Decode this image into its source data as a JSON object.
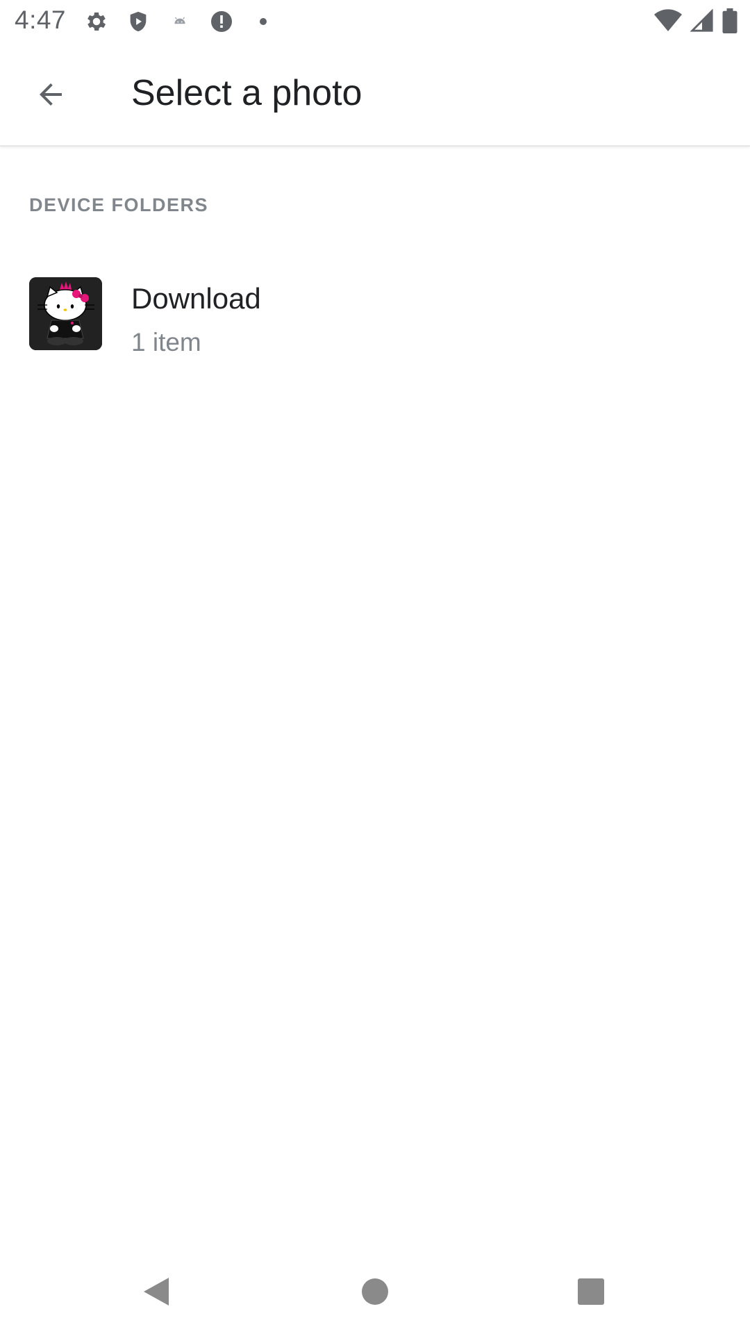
{
  "status_bar": {
    "time": "4:47",
    "icons_left": [
      "gear-icon",
      "shield-play-icon",
      "android-icon",
      "alert-icon",
      "dot-icon"
    ],
    "icons_right": [
      "wifi-icon",
      "signal-icon",
      "battery-icon"
    ]
  },
  "app_bar": {
    "title": "Select a photo",
    "back_icon": "arrow-back-icon"
  },
  "section": {
    "header": "DEVICE FOLDERS"
  },
  "folders": [
    {
      "name": "Download",
      "count": "1 item",
      "thumbnail": "hello-kitty-thumbnail"
    }
  ],
  "nav_bar": {
    "buttons": [
      "back-triangle-icon",
      "home-circle-icon",
      "recents-square-icon"
    ]
  },
  "colors": {
    "icon_gray": "#5f6368",
    "title_text": "#202124",
    "secondary_text": "#80868b",
    "nav_icon": "#8a8a8a",
    "accent_pink": "#e6157a"
  }
}
